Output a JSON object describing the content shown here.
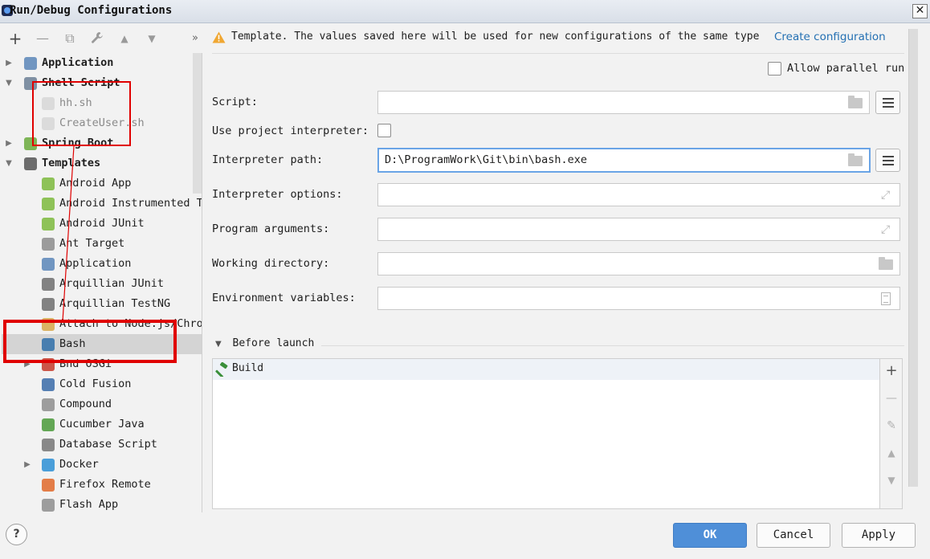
{
  "window": {
    "title": "Run/Debug Configurations",
    "close_glyph": "✕"
  },
  "toolbar": {
    "icons": [
      "add-icon",
      "remove-icon",
      "copy-icon",
      "wrench-icon",
      "move-up-icon",
      "move-down-icon",
      "more-icon"
    ],
    "glyphs": [
      "+",
      "—",
      "⧉",
      "🔧",
      "▲",
      "▼",
      "»"
    ]
  },
  "tree": {
    "items": [
      {
        "label": "Application",
        "kind": "group",
        "expanded": false,
        "icon": "application-icon"
      },
      {
        "label": "Shell Script",
        "kind": "group",
        "expanded": true,
        "icon": "shell-script-icon"
      },
      {
        "label": "hh.sh",
        "kind": "child-gray",
        "icon": "script-file-icon"
      },
      {
        "label": "CreateUser.sh",
        "kind": "child-gray",
        "icon": "script-file-icon"
      },
      {
        "label": "Spring Boot",
        "kind": "group",
        "expanded": false,
        "icon": "spring-boot-icon"
      },
      {
        "label": "Templates",
        "kind": "group",
        "expanded": true,
        "icon": "wrench-icon"
      },
      {
        "label": "Android App",
        "kind": "child",
        "icon": "android-icon"
      },
      {
        "label": "Android Instrumented T",
        "kind": "child",
        "icon": "android-test-icon"
      },
      {
        "label": "Android JUnit",
        "kind": "child",
        "icon": "android-junit-icon"
      },
      {
        "label": "Ant Target",
        "kind": "child",
        "icon": "ant-icon"
      },
      {
        "label": "Application",
        "kind": "child",
        "icon": "application-icon"
      },
      {
        "label": "Arquillian JUnit",
        "kind": "child",
        "icon": "arquillian-icon"
      },
      {
        "label": "Arquillian TestNG",
        "kind": "child",
        "icon": "arquillian-icon"
      },
      {
        "label": "Attach to Node.js/Chrome",
        "kind": "child",
        "icon": "nodejs-icon"
      },
      {
        "label": "Bash",
        "kind": "child",
        "selected": true,
        "icon": "bash-icon"
      },
      {
        "label": "Bnd OSGi",
        "kind": "child-expandable",
        "icon": "bnd-icon"
      },
      {
        "label": "Cold Fusion",
        "kind": "child",
        "icon": "coldfusion-icon"
      },
      {
        "label": "Compound",
        "kind": "child",
        "icon": "compound-icon"
      },
      {
        "label": "Cucumber Java",
        "kind": "child",
        "icon": "cucumber-icon"
      },
      {
        "label": "Database Script",
        "kind": "child",
        "icon": "database-icon"
      },
      {
        "label": "Docker",
        "kind": "child-expandable",
        "icon": "docker-icon"
      },
      {
        "label": "Firefox Remote",
        "kind": "child",
        "icon": "firefox-icon"
      },
      {
        "label": "Flash App",
        "kind": "child",
        "icon": "flash-icon"
      }
    ]
  },
  "header": {
    "warning_text": "Template. The values saved here will be used for new configurations of the same type",
    "link_text": "Create configuration"
  },
  "form": {
    "allow_parallel_label": "Allow parallel run",
    "script_label": "Script:",
    "script_value": "",
    "use_interpreter_label": "Use project interpreter:",
    "interpreter_path_label": "Interpreter path:",
    "interpreter_path_value": "D:\\ProgramWork\\Git\\bin\\bash.exe",
    "interpreter_options_label": "Interpreter options:",
    "program_arguments_label": "Program arguments:",
    "working_directory_label": "Working directory:",
    "environment_variables_label": "Environment variables:"
  },
  "before_launch": {
    "title": "Before launch",
    "items": [
      "Build"
    ],
    "tools": [
      "+",
      "—",
      "✎",
      "▲",
      "▼"
    ]
  },
  "footer": {
    "help": "?",
    "ok": "OK",
    "cancel": "Cancel",
    "apply": "Apply"
  },
  "colors": {
    "accent": "#4f8fd8",
    "link": "#2470b3",
    "annotation": "#e00000",
    "selection": "#d4d4d4"
  }
}
